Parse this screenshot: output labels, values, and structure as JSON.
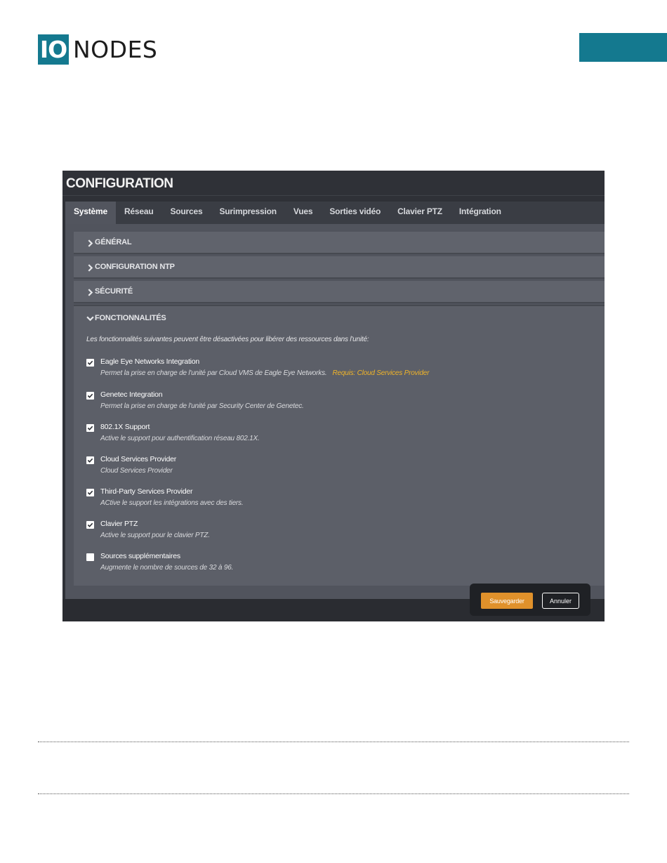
{
  "logo": {
    "box_text": "IO",
    "text": "NODES"
  },
  "brand_color": "#14798f",
  "screen": {
    "title": "CONFIGURATION",
    "tabs": [
      {
        "label": "Système",
        "active": true
      },
      {
        "label": "Réseau"
      },
      {
        "label": "Sources"
      },
      {
        "label": "Surimpression"
      },
      {
        "label": "Vues"
      },
      {
        "label": "Sorties vidéo"
      },
      {
        "label": "Clavier PTZ"
      },
      {
        "label": "Intégration"
      }
    ],
    "sections": [
      {
        "label": "GÉNÉRAL",
        "expanded": false
      },
      {
        "label": "CONFIGURATION NTP",
        "expanded": false
      },
      {
        "label": "SÉCURITÉ",
        "expanded": false
      },
      {
        "label": "FONCTIONNALITÉS",
        "expanded": true
      }
    ],
    "features_intro": "Les fonctionnalités suivantes peuvent être désactivées pour libérer des ressources dans l'unité:",
    "features": [
      {
        "label": "Eagle Eye Networks Integration",
        "description": "Permet la prise en charge de l'unité par Cloud VMS de Eagle Eye Networks.",
        "requirement": "Requis: Cloud Services Provider",
        "checked": true
      },
      {
        "label": "Genetec Integration",
        "description": "Permet la prise en charge de l'unité par Security Center de Genetec.",
        "checked": true
      },
      {
        "label": "802.1X Support",
        "description": "Active le support pour authentification réseau 802.1X.",
        "checked": true
      },
      {
        "label": "Cloud Services Provider",
        "description": "Cloud Services Provider",
        "checked": true
      },
      {
        "label": "Third-Party Services Provider",
        "description": "ACtive le support les intégrations avec des tiers.",
        "checked": true
      },
      {
        "label": "Clavier PTZ",
        "description": "Active le support pour le clavier PTZ.",
        "checked": true
      },
      {
        "label": "Sources supplémentaires",
        "description": "Augmente le nombre de sources de 32 à 96.",
        "checked": false
      }
    ],
    "buttons": {
      "save": "Sauvegarder",
      "cancel": "Annuler"
    },
    "colors": {
      "save_button": "#e0912b",
      "requirement_text": "#f0b429"
    }
  }
}
